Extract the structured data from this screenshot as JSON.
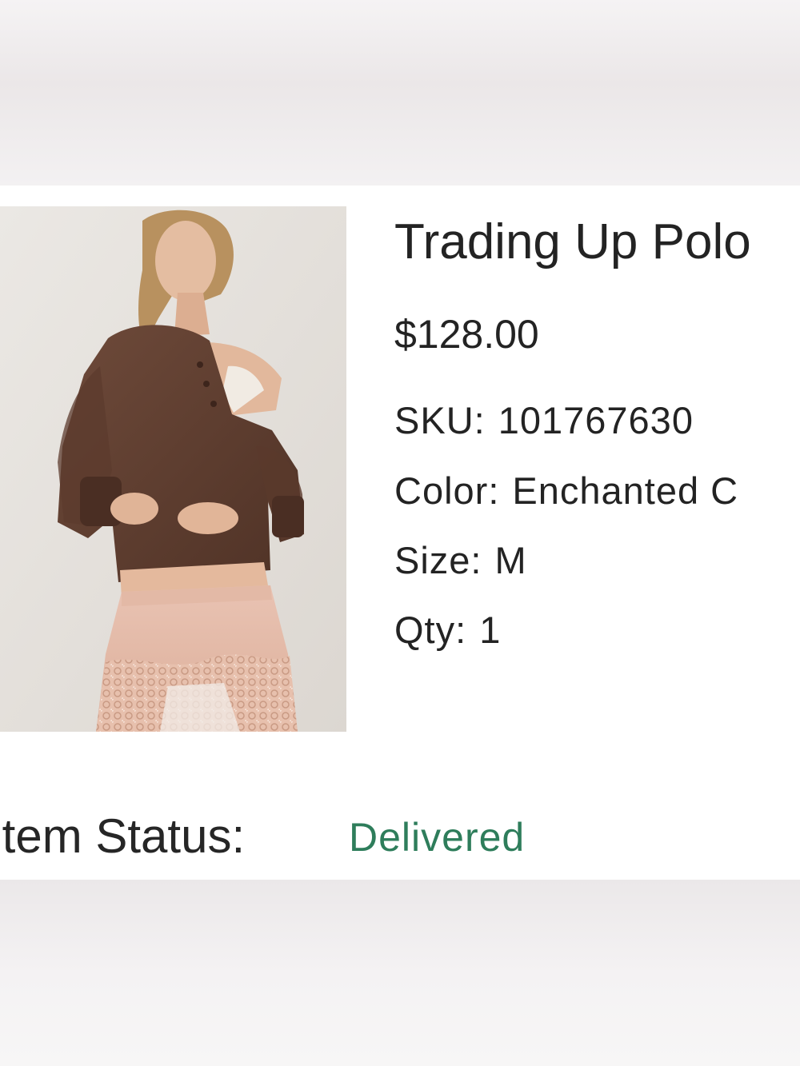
{
  "product": {
    "title": "Trading Up Polo",
    "price": "$128.00",
    "sku_label": "SKU:",
    "sku_value": "101767630",
    "color_label": "Color:",
    "color_value": "Enchanted C",
    "size_label": "Size:",
    "size_value": "M",
    "qty_label": "Qty:",
    "qty_value": "1"
  },
  "status": {
    "label": "Item Status:",
    "value": "Delivered",
    "value_color": "#2e7d5b"
  }
}
